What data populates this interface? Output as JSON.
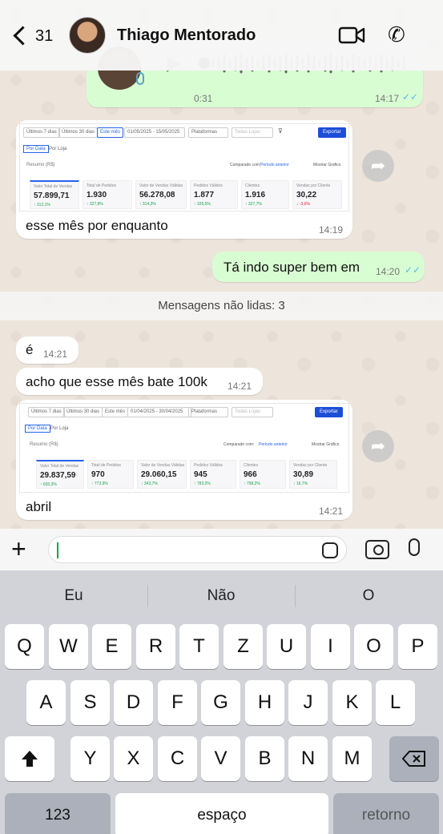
{
  "header": {
    "back_count": "31",
    "contact_name": "Thiago Mentorado"
  },
  "messages": {
    "voice": {
      "duration": "0:31",
      "time": "14:17",
      "ticks": "✓✓"
    },
    "img1": {
      "caption": "esse mês por enquanto",
      "time": "14:19",
      "shot": {
        "filters": [
          "Últimos 7 dias",
          "Últimos 30 dias",
          "Este mês"
        ],
        "date_range": "01/05/2025 - 15/05/2025",
        "platform": "Plataformas",
        "store": "Todas Lojas",
        "export": "Exportar",
        "tabs": [
          "Por Data",
          "Por Loja"
        ],
        "summary": "Resumo (R$)",
        "compare_label": "Comparado com:",
        "compare_value": "Período anterior",
        "chart_toggle": "Mostrar Gráfico",
        "cards": [
          {
            "label": "Valor Total de Vendas",
            "value": "57.899,71",
            "delta": "↑ 312,1%"
          },
          {
            "label": "Total de Pedidos",
            "value": "1.930",
            "delta": "↑ 327,8%"
          },
          {
            "label": "Valor de Vendas Válidas",
            "value": "56.278,08",
            "delta": "↑ 314,3%"
          },
          {
            "label": "Pedidos Válidos",
            "value": "1.877",
            "delta": "↑ 329,5%"
          },
          {
            "label": "Clientes",
            "value": "1.916",
            "delta": "↑ 327,7%"
          },
          {
            "label": "Vendas por Cliente",
            "value": "30,22",
            "delta": "↓ -3,6%"
          }
        ]
      }
    },
    "out1": {
      "text": "Tá indo super bem em",
      "time": "14:20",
      "ticks": "✓✓"
    },
    "unread_label": "Mensagens não lidas: 3",
    "in1": {
      "text": "é",
      "time": "14:21"
    },
    "in2": {
      "text": "acho que esse mês bate 100k",
      "time": "14:21"
    },
    "img2": {
      "caption": "abril",
      "time": "14:21",
      "shot": {
        "filters": [
          "Últimos 7 dias",
          "Últimos 30 dias",
          "Este mês"
        ],
        "date_range": "01/04/2025 - 30/04/2025",
        "platform": "Plataformas",
        "store": "Todas Lojas",
        "export": "Exportar",
        "tabs": [
          "Por Data",
          "Por Loja"
        ],
        "summary": "Resumo (R$)",
        "compare_label": "Comparado com:",
        "compare_value": "Período anterior",
        "chart_toggle": "Mostrar Gráfico",
        "cards": [
          {
            "label": "Valor Total de Vendas",
            "value": "29.837,59",
            "delta": "↑ 630,3%"
          },
          {
            "label": "Total de Pedidos",
            "value": "970",
            "delta": "↑ 773,9%"
          },
          {
            "label": "Valor de Vendas Válidas",
            "value": "29.060,15",
            "delta": "↑ 343,7%"
          },
          {
            "label": "Pedidos Válidos",
            "value": "945",
            "delta": "↑ 783,2%"
          },
          {
            "label": "Clientes",
            "value": "966",
            "delta": "↑ 798,2%"
          },
          {
            "label": "Vendas por Cliente",
            "value": "30,89",
            "delta": "↑ 16,7%"
          }
        ]
      }
    }
  },
  "keyboard": {
    "suggestions": [
      "Eu",
      "Não",
      "O"
    ],
    "row1": [
      "Q",
      "W",
      "E",
      "R",
      "T",
      "Z",
      "U",
      "I",
      "O",
      "P"
    ],
    "row2": [
      "A",
      "S",
      "D",
      "F",
      "G",
      "H",
      "J",
      "K",
      "L"
    ],
    "row3": [
      "Y",
      "X",
      "C",
      "V",
      "B",
      "N",
      "M"
    ],
    "numbers": "123",
    "space": "espaço",
    "return": "retorno"
  }
}
